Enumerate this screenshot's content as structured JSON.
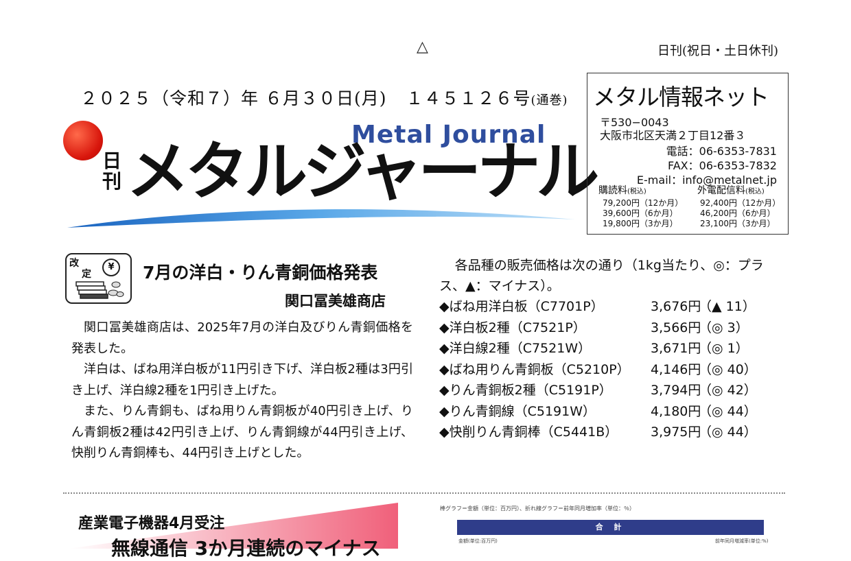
{
  "header": {
    "mark": "△",
    "frequency": "日刊(祝日・土日休刊)",
    "date": "２０２５（令和７）年 ６月３０日(月)",
    "issue_no": "１４５１２６号",
    "issue_suffix": "(通巻)"
  },
  "masthead": {
    "nikkan": "日刊",
    "english_title": "Metal Journal",
    "japanese_title": "メタルジャーナル",
    "colors": {
      "sun": "#d8160c",
      "swoosh": "#2f7fd0",
      "english": "#2f4e9e"
    }
  },
  "publisher_box": {
    "name": "メタル情報ネット",
    "zip": "〒530−0043",
    "address": "大阪市北区天満２丁目12番３",
    "tel": "電話：06-6353-7831",
    "fax": "FAX：06-6353-7832",
    "email": "E-mail：info@metalnet.jp",
    "subscription_label": "購読料",
    "subscription_tax": "(税込)",
    "subscription_rows": [
      "79,200円（12か月）",
      "39,600円（6か月）",
      "19,800円（3か月）"
    ],
    "distribution_label": "外電配信料",
    "distribution_tax": "(税込)",
    "distribution_rows": [
      "92,400円（12か月）",
      "46,200円（6か月）",
      "23,100円（3か月）"
    ]
  },
  "article1": {
    "badge_top": "改",
    "badge_bottom": "定",
    "badge_yen": "¥",
    "headline": "7月の洋白・りん青銅価格発表",
    "byline": "関口冨美雄商店",
    "paragraphs": [
      "関口冨美雄商店は、2025年7月の洋白及びりん青銅価格を発表した。",
      "洋白は、ばね用洋白板が11円引き下げ、洋白板2種は3円引き上げ、洋白線2種を1円引き上げた。",
      "また、りん青銅も、ばね用りん青銅板が40円引き上げ、りん青銅板2種は42円引き上げ、りん青銅線が44円引き上げ、快削りん青銅棒も、44円引き上げとした。"
    ],
    "price_intro": "各品種の販売価格は次の通り（1kg当たり、◎：プラス、▲：マイナス）。",
    "prices": [
      {
        "name": "◆ばね用洋白板（C7701P）",
        "price": "3,676円",
        "change": "（▲ 11）"
      },
      {
        "name": "◆洋白板2種（C7521P）",
        "price": "3,566円",
        "change": "（◎ 3）"
      },
      {
        "name": "◆洋白線2種（C7521W）",
        "price": "3,671円",
        "change": "（◎ 1）"
      },
      {
        "name": "◆ばね用りん青銅板（C5210P）",
        "price": "4,146円",
        "change": "（◎ 40）"
      },
      {
        "name": "◆りん青銅板2種（C5191P）",
        "price": "3,794円",
        "change": "（◎ 42）"
      },
      {
        "name": "◆りん青銅線（C5191W）",
        "price": "4,180円",
        "change": "（◎ 44）"
      },
      {
        "name": "◆快削りん青銅棒（C5441B）",
        "price": "3,975円",
        "change": "（◎ 44）"
      }
    ]
  },
  "article2": {
    "headline": "産業電子機器4月受注",
    "subheadline": "無線通信 3か月連続のマイナス",
    "chart_caption": "棒グラフ＝金額（単位：百万円）、折れ線グラフ＝前年同月増加率（単位：％）",
    "chart_header": "合 計",
    "left_axis_label": "金額(単位:百万円)",
    "right_axis_label": "前年同月増減率(単位:%)"
  }
}
